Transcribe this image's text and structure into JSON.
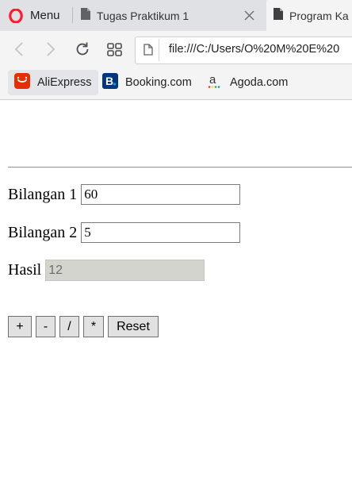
{
  "browser": {
    "menu_label": "Menu",
    "tabs": [
      {
        "title": "Tugas Praktikum 1"
      },
      {
        "title": "Program Ka"
      }
    ],
    "url": "file:///C:/Users/O%20M%20E%20",
    "bookmarks": [
      {
        "label": "AliExpress",
        "icon": "aliexpress-icon",
        "color": "#e62e04"
      },
      {
        "label": "Booking.com",
        "icon": "booking-icon",
        "color": "#003580"
      },
      {
        "label": "Agoda.com",
        "icon": "agoda-icon",
        "color": "#333333"
      }
    ]
  },
  "form": {
    "bilangan1_label": "Bilangan 1",
    "bilangan1_value": "60",
    "bilangan2_label": "Bilangan 2",
    "bilangan2_value": "5",
    "hasil_label": "Hasil",
    "hasil_value": "12"
  },
  "buttons": {
    "add": "+",
    "subtract": "-",
    "divide": "/",
    "multiply": "*",
    "reset": "Reset"
  },
  "colors": {
    "opera_red": "#ff1b2d",
    "tabstrip_bg": "#dfe1e5",
    "toolbar_bg": "#f4f4f5",
    "disabled_field": "#d4d4cf"
  }
}
